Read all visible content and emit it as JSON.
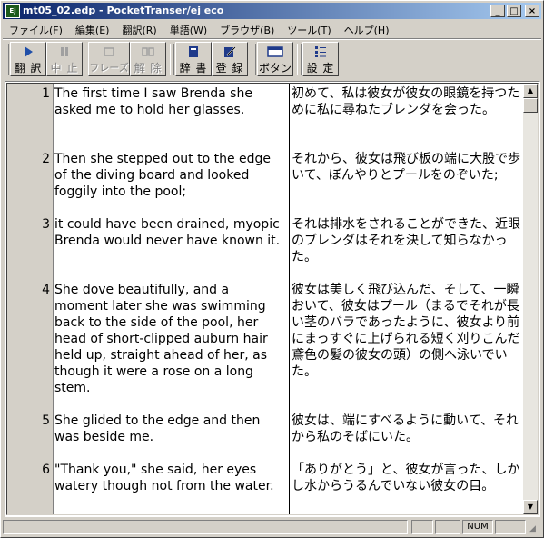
{
  "window": {
    "title": "mt05_02.edp - PocketTranser/ej eco",
    "app_icon": "Ej",
    "controls": {
      "minimize": "_",
      "maximize": "□",
      "close": "×"
    }
  },
  "menu": [
    "ファイル(F)",
    "編集(E)",
    "翻訳(R)",
    "単語(W)",
    "ブラウザ(B)",
    "ツール(T)",
    "ヘルプ(H)"
  ],
  "toolbar": {
    "translate": {
      "label": "翻 訳",
      "icon": "play-icon"
    },
    "stop": {
      "label": "中 止",
      "icon": "pause-icon"
    },
    "phrase": {
      "label": "フレーズ",
      "icon": "phrase-icon"
    },
    "release": {
      "label": "解 除",
      "icon": "release-icon"
    },
    "dictionary": {
      "label": "辞 書",
      "icon": "dictionary-icon"
    },
    "register": {
      "label": "登 録",
      "icon": "register-icon"
    },
    "button": {
      "label": "ボタン",
      "icon": "button-icon"
    },
    "settings": {
      "label": "設 定",
      "icon": "settings-icon"
    }
  },
  "rows": [
    {
      "num": "1",
      "en": "The first time I saw Brenda she asked me to hold her glasses.",
      "ja": "初めて、私は彼女が彼女の眼鏡を持つために私に尋ねたブレンダを会った。"
    },
    {
      "num": "2",
      "en": "Then she stepped out to the edge of the diving board and looked foggily into the pool;",
      "ja": "それから、彼女は飛び板の端に大股で歩いて、ぼんやりとプールをのぞいた;"
    },
    {
      "num": "3",
      "en": "it could have been drained, myopic Brenda would never have known it.",
      "ja": "それは排水をされることができた、近眼のブレンダはそれを決して知らなかった。"
    },
    {
      "num": "4",
      "en": "She dove beautifully, and a moment later she was swimming back to the side of the pool, her head of short-clipped auburn hair held up, straight ahead of her, as though it were a rose on a long stem.",
      "ja": "彼女は美しく飛び込んだ、そして、一瞬おいて、彼女はプール（まるでそれが長い茎のバラであったように、彼女より前にまっすぐに上げられる短く刈りこんだ鳶色の髪の彼女の頭）の側へ泳いでいた。"
    },
    {
      "num": "5",
      "en": "She glided to the edge and then was beside me.",
      "ja": "彼女は、端にすべるように動いて、それから私のそばにいた。"
    },
    {
      "num": "6",
      "en": "\"Thank you,\" she said, her eyes watery though not from the water.",
      "ja": "「ありがとう」と、彼女が言った、しかし水からうるんでいない彼女の目。"
    }
  ],
  "status": {
    "num_indicator": "NUM"
  }
}
